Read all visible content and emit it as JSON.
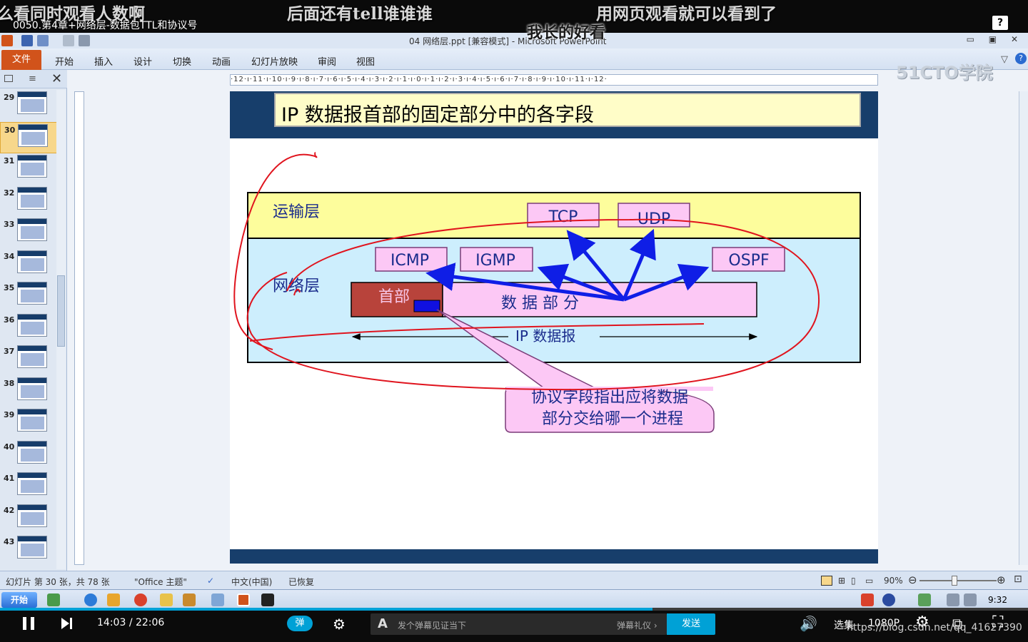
{
  "danmaku": [
    {
      "text": "么看同时观看人数啊"
    },
    {
      "text": "后面还有tell谁谁谁"
    },
    {
      "text": "用网页观看就可以看到了"
    },
    {
      "text": "我长的好看"
    }
  ],
  "video": {
    "title": "0050.第4章+网络层-数据包TTL和协议号",
    "current_time": "14:03",
    "separator": "/",
    "total_time": "22:06",
    "progress_fraction": 0.635,
    "danmu_toggle_label": "弹",
    "danmu_placeholder": "发个弹幕见证当下",
    "danmu_gift_label": "弹幕礼仪 ›",
    "send_label": "发送",
    "select_label": "选集",
    "quality_label": "1080P",
    "watermark": "https://blog.csdn.net/qq_41627390",
    "help_label": "?"
  },
  "powerpoint": {
    "doc_title": "04 网络层.ppt [兼容模式]  -  Microsoft PowerPoint",
    "logo": "51CTO学院",
    "tabs": [
      {
        "label": "文件"
      },
      {
        "label": "开始"
      },
      {
        "label": "插入"
      },
      {
        "label": "设计"
      },
      {
        "label": "切换"
      },
      {
        "label": "动画"
      },
      {
        "label": "幻灯片放映"
      },
      {
        "label": "审阅"
      },
      {
        "label": "视图"
      }
    ],
    "ruler_text": "·12·ı·11·ı·10·ı·9·ı·8·ı·7·ı·6·ı·5·ı·4·ı·3·ı·2·ı·1·ı·0·ı·1·ı·2·ı·3·ı·4·ı·5·ı·6·ı·7·ı·8·ı·9·ı·10·ı·11·ı·12·",
    "slide_numbers": [
      "29",
      "30",
      "31",
      "32",
      "33",
      "34",
      "35",
      "36",
      "37",
      "38",
      "39",
      "40",
      "41",
      "42",
      "43"
    ],
    "selected_slide": "30",
    "status": {
      "slide_info": "幻灯片 第 30 张，共 78 张",
      "theme": "\"Office 主题\"",
      "language": "中文(中国)",
      "recovered": "已恢复",
      "zoom": "90%"
    },
    "taskbar": {
      "start_label": "开始",
      "clock": "9:32"
    }
  },
  "slide": {
    "title": "IP 数据报首部的固定部分中的各字段",
    "transport_layer": "运输层",
    "network_layer": "网络层",
    "tcp": "TCP",
    "udp": "UDP",
    "icmp": "ICMP",
    "igmp": "IGMP",
    "ospf": "OSPF",
    "header": "首部",
    "data_part": "数 据 部 分",
    "ip_datagram": "IP 数据报",
    "callout_line1": "协议字段指出应将数据",
    "callout_line2": "部分交给哪一个进程"
  },
  "colors": {
    "accent": "#00a1d6",
    "slide_band": "#173e6b",
    "file_tab": "#d1531b",
    "transport_bg": "#fdfd9c",
    "network_bg": "#cdeefd",
    "proto_box": "#fcc8f5",
    "header_fill": "#b8433b",
    "arrow": "#0f1ee6",
    "ink": "#e0141e"
  }
}
